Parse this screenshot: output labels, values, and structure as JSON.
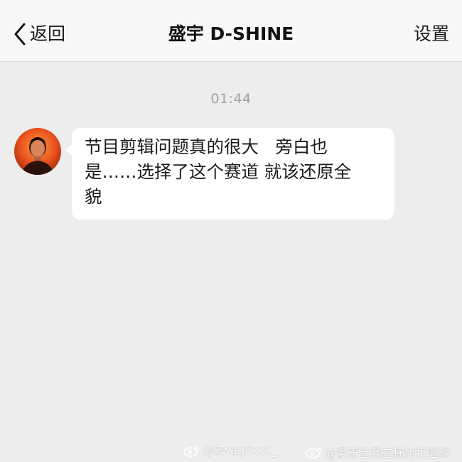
{
  "nav": {
    "back_label": "返回",
    "title": "盛宇 D-SHINE",
    "settings_label": "设置"
  },
  "chat": {
    "timestamp": "01:44",
    "messages": [
      {
        "sender_avatar_icon": "user-avatar",
        "text": "节目剪辑问题真的很大   旁白也\n是……选择了这个赛道 就该还原全\n貌"
      }
    ]
  },
  "watermarks": [
    {
      "icon": "weibo-icon",
      "text": "@SwagFxxk_"
    },
    {
      "icon": "weibo-icon",
      "text": "@爱奇艺我在横店打篮球"
    }
  ],
  "colors": {
    "nav_bg": "#f7f7f7",
    "chat_bg": "#ededed",
    "bubble_bg": "#ffffff",
    "timestamp": "#a3a3a3",
    "text": "#1a1a1a"
  }
}
